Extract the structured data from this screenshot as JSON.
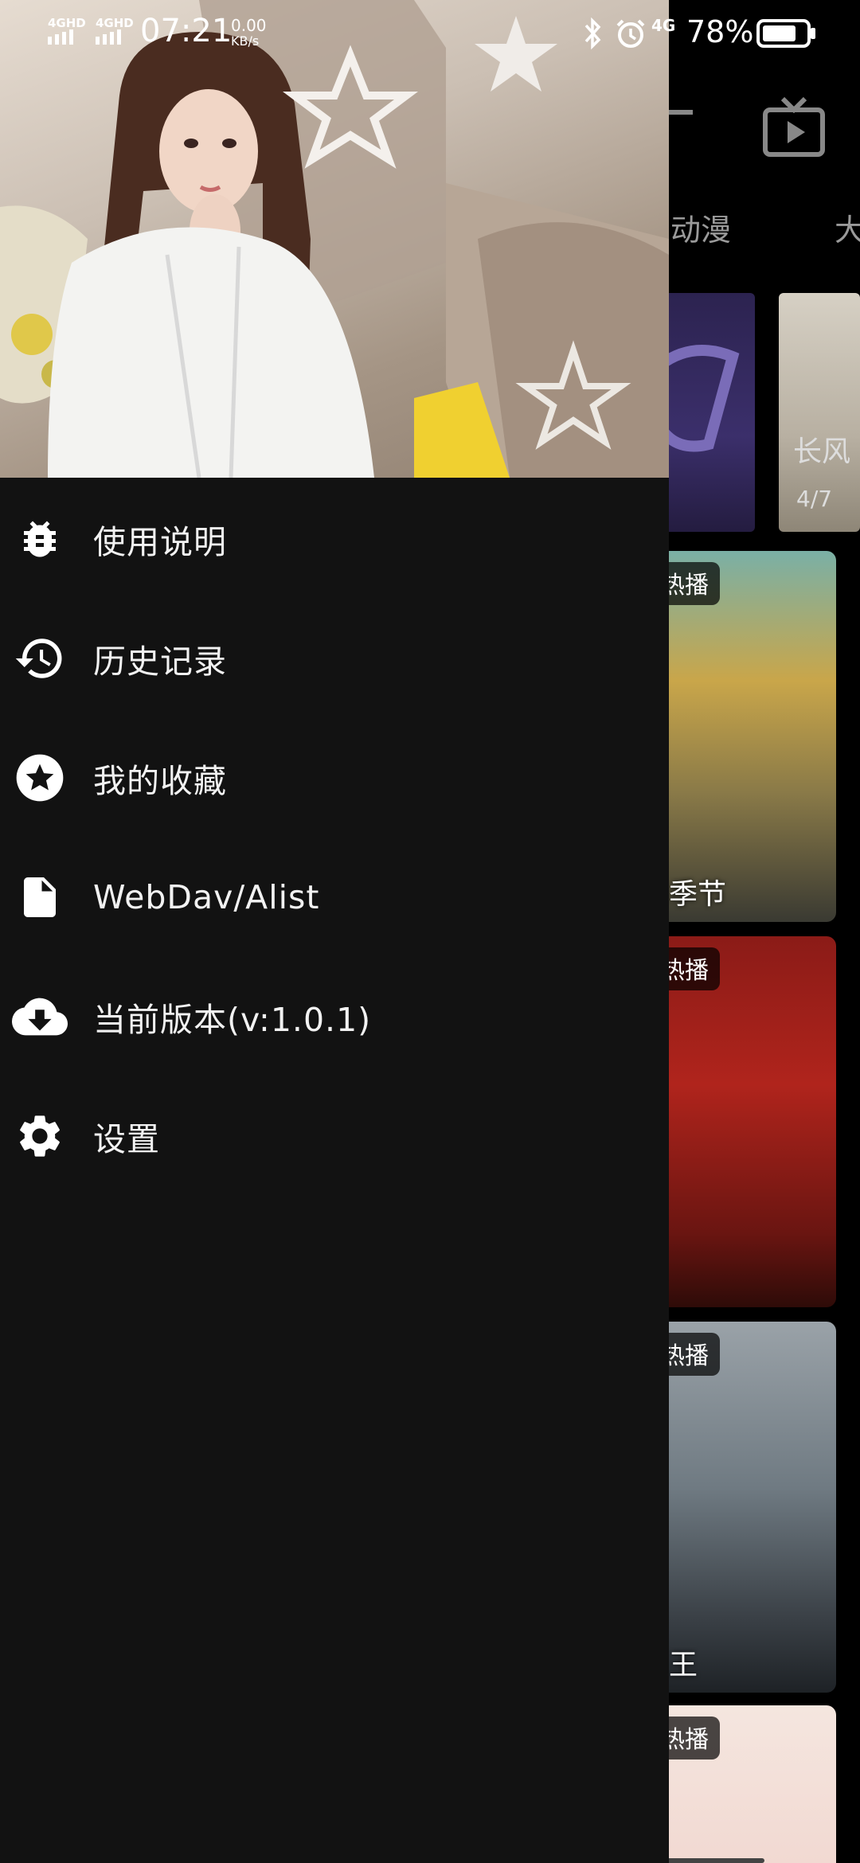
{
  "status_bar": {
    "sim1": "4GHD",
    "sim2": "4GHD",
    "time": "07:21",
    "speed_value": "0.00",
    "speed_unit": "KB/s",
    "net4g": "4G",
    "battery_percent": "78%",
    "battery_level": 0.78
  },
  "drawer": {
    "menu": [
      {
        "label": "使用说明",
        "icon": "bug-icon"
      },
      {
        "label": "历史记录",
        "icon": "history-icon"
      },
      {
        "label": "我的收藏",
        "icon": "star-icon"
      },
      {
        "label": "WebDav/Alist",
        "icon": "file-icon"
      },
      {
        "label": "当前版本(v:1.0.1)",
        "icon": "cloud-download-icon"
      },
      {
        "label": "设置",
        "icon": "gear-icon"
      }
    ]
  },
  "background": {
    "tabs": [
      "动漫",
      "大"
    ],
    "banner_label": "长风",
    "banner_counter": "4/7",
    "posters": [
      {
        "badge": "热播",
        "title": "季节"
      },
      {
        "badge": "热播",
        "title": ""
      },
      {
        "badge": "热播",
        "title": "王"
      },
      {
        "badge": "热播",
        "title": ""
      }
    ]
  },
  "colors": {
    "drawer_bg": "#121212",
    "page_bg": "#000000",
    "text": "#f2f2f2"
  }
}
